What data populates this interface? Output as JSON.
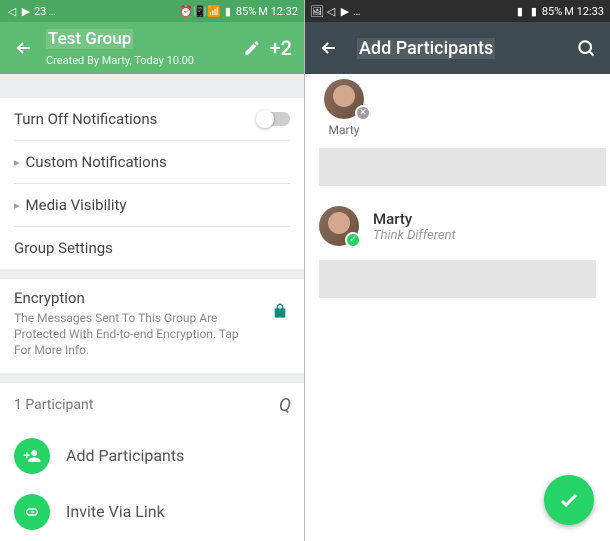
{
  "status": {
    "left_badge": "23",
    "time_left": "M 12:32",
    "time_right": "M 12:33",
    "battery_left": "85%",
    "battery_right": "85%",
    "signal_icon": "wifi-icon"
  },
  "left": {
    "header": {
      "title": "Test Group",
      "subtitle": "Created By Marty, Today 10:00",
      "participant_count": "+2"
    },
    "rows": {
      "turn_off_notifications": "Turn Off Notifications",
      "custom_notifications": "Custom Notifications",
      "media_visibility": "Media Visibility",
      "group_settings": "Group Settings"
    },
    "encryption": {
      "title": "Encryption",
      "text": "The Messages Sent To This Group Are Protected With End-to-end Encryption. Tap For More Info."
    },
    "participants": {
      "count": "1 Participant",
      "add_participants": "Add Participants",
      "invite_via_link": "Invite Via Link"
    }
  },
  "right": {
    "header": {
      "title": "Add Participants"
    },
    "selected": {
      "name": "Marty"
    },
    "contacts": [
      {
        "name": "Marty",
        "status": "Think Different"
      }
    ]
  }
}
